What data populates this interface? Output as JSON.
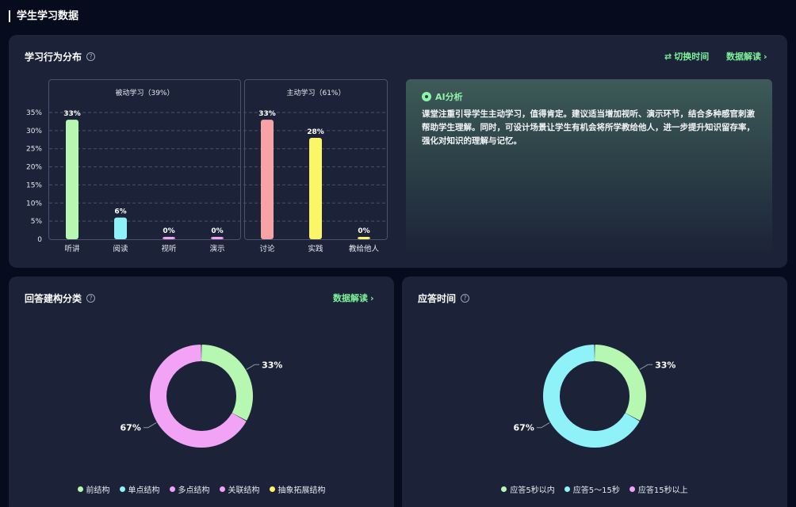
{
  "page": {
    "title": "学生学习数据"
  },
  "behavior": {
    "title": "学习行为分布",
    "switch_time": "切换时间",
    "interpret": "数据解读",
    "passive_title": "被动学习（39%）",
    "active_title": "主动学习（61%）",
    "y_ticks": [
      "35%",
      "30%",
      "25%",
      "20%",
      "15%",
      "10%",
      "5%",
      "0"
    ]
  },
  "ai": {
    "title": "AI分析",
    "text": "课堂注重引导学生主动学习，值得肯定。建议适当增加视听、演示环节，结合多种感官刺激帮助学生理解。同时，可设计场景让学生有机会将所学教给他人，进一步提升知识留存率，强化对知识的理解与记忆。"
  },
  "structure": {
    "title": "回答建构分类",
    "interpret": "数据解读",
    "legend": [
      {
        "label": "前结构",
        "color": "#b6f7b1"
      },
      {
        "label": "单点结构",
        "color": "#8ef2f8"
      },
      {
        "label": "多点结构",
        "color": "#f3a3f6"
      },
      {
        "label": "关联结构",
        "color": "#f3a3f6"
      },
      {
        "label": "抽象拓展结构",
        "color": "#fbf56a"
      }
    ]
  },
  "response_time": {
    "title": "应答时间",
    "legend": [
      {
        "label": "应答5秒以内",
        "color": "#b6f7b1"
      },
      {
        "label": "应答5～15秒",
        "color": "#8ef2f8"
      },
      {
        "label": "应答15秒以上",
        "color": "#f3a3f6"
      }
    ]
  },
  "chart_data": [
    {
      "type": "bar",
      "title": "被动学习（39%）",
      "categories": [
        "听讲",
        "阅读",
        "视听",
        "演示"
      ],
      "values": [
        33,
        6,
        0,
        0
      ],
      "labels": [
        "33%",
        "6%",
        "0%",
        "0%"
      ],
      "colors": [
        "#b6f7b1",
        "#8ef2f8",
        "#f3a3f6",
        "#f3a3f6"
      ],
      "ylim": [
        0,
        35
      ],
      "grid": true
    },
    {
      "type": "bar",
      "title": "主动学习（61%）",
      "categories": [
        "讨论",
        "实践",
        "教给他人"
      ],
      "values": [
        33,
        28,
        0
      ],
      "labels": [
        "33%",
        "28%",
        "0%"
      ],
      "colors": [
        "#f7a3a5",
        "#fbf56a",
        "#fbf56a"
      ],
      "ylim": [
        0,
        35
      ],
      "grid": true
    },
    {
      "type": "pie",
      "title": "回答建构分类",
      "categories": [
        "前结构",
        "多点结构"
      ],
      "values": [
        33,
        67
      ],
      "labels": [
        "33%",
        "67%"
      ],
      "colors": [
        "#b6f7b1",
        "#f3a3f6"
      ]
    },
    {
      "type": "pie",
      "title": "应答时间",
      "categories": [
        "应答5秒以内",
        "应答5～15秒"
      ],
      "values": [
        33,
        67
      ],
      "labels": [
        "33%",
        "67%"
      ],
      "colors": [
        "#b6f7b1",
        "#8ef2f8"
      ]
    }
  ]
}
